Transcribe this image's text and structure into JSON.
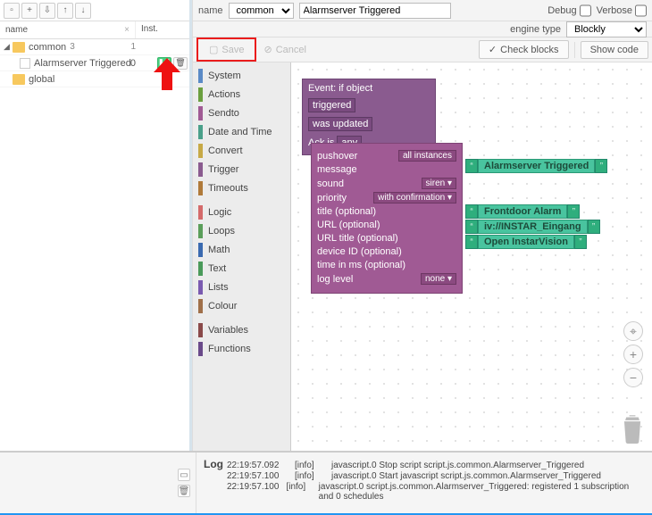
{
  "toolbar_icons": [
    "file-icon",
    "plus-icon",
    "download-icon",
    "up-icon",
    "down-icon"
  ],
  "grid": {
    "name_header": "name",
    "inst_header": "Inst."
  },
  "tree": {
    "items": [
      {
        "label": "common",
        "badge": "3"
      },
      {
        "label": "Alarmserver Triggered",
        "count": "0"
      },
      {
        "label": "global"
      }
    ]
  },
  "header": {
    "name_label": "name",
    "folder_select": "common",
    "script_name": "Alarmserver Triggered",
    "debug_label": "Debug",
    "verbose_label": "Verbose",
    "engine_label": "engine type",
    "engine_value": "Blockly"
  },
  "actions": {
    "save": "Save",
    "cancel": "Cancel",
    "check": "Check blocks",
    "showcode": "Show code"
  },
  "toolbox": [
    {
      "label": "System",
      "color": "#5a8ac6"
    },
    {
      "label": "Actions",
      "color": "#6b9f3f"
    },
    {
      "label": "Sendto",
      "color": "#a05a94"
    },
    {
      "label": "Date and Time",
      "color": "#4aa08a"
    },
    {
      "label": "Convert",
      "color": "#c7a946"
    },
    {
      "label": "Trigger",
      "color": "#8a5b8f"
    },
    {
      "label": "Timeouts",
      "color": "#b07a3a"
    },
    {
      "label": "Logic",
      "color": "#d46a6a"
    },
    {
      "label": "Loops",
      "color": "#5a9e5a"
    },
    {
      "label": "Math",
      "color": "#3a6ab0"
    },
    {
      "label": "Text",
      "color": "#4a9a5a"
    },
    {
      "label": "Lists",
      "color": "#7a5ab0"
    },
    {
      "label": "Colour",
      "color": "#a0704a"
    },
    {
      "label": "Variables",
      "color": "#8a4a4a"
    },
    {
      "label": "Functions",
      "color": "#6a4a8a"
    }
  ],
  "blocks": {
    "trigger": {
      "title": "Event: if object",
      "object": "triggered",
      "cond": "was updated",
      "ack_label": "Ack is",
      "ack_val": "any"
    },
    "pushover": {
      "head": "pushover",
      "head_val": "all instances",
      "rows": [
        {
          "lab": "message",
          "val": "",
          "str": "Alarmserver Triggered"
        },
        {
          "lab": "sound",
          "val": "siren",
          "str": ""
        },
        {
          "lab": "priority",
          "val": "with confirmation",
          "str": ""
        },
        {
          "lab": "title (optional)",
          "val": "",
          "str": "Frontdoor Alarm"
        },
        {
          "lab": "URL (optional)",
          "val": "",
          "str": "iv://INSTAR_Eingang"
        },
        {
          "lab": "URL title (optional)",
          "val": "",
          "str": "Open InstarVision"
        },
        {
          "lab": "device ID (optional)",
          "val": "",
          "str": ""
        },
        {
          "lab": "time in ms (optional)",
          "val": "",
          "str": ""
        },
        {
          "lab": "log level",
          "val": "none",
          "str": ""
        }
      ]
    }
  },
  "log": {
    "header": "Log",
    "lines": [
      {
        "ts": "22:19:57.092",
        "lvl": "[info]",
        "msg": "javascript.0 Stop script script.js.common.Alarmserver_Triggered"
      },
      {
        "ts": "22:19:57.100",
        "lvl": "[info]",
        "msg": "javascript.0 Start javascript script.js.common.Alarmserver_Triggered"
      },
      {
        "ts": "22:19:57.100",
        "lvl": "[info]",
        "msg": "javascript.0 script.js.common.Alarmserver_Triggered: registered 1 subscription and 0 schedules"
      }
    ]
  }
}
